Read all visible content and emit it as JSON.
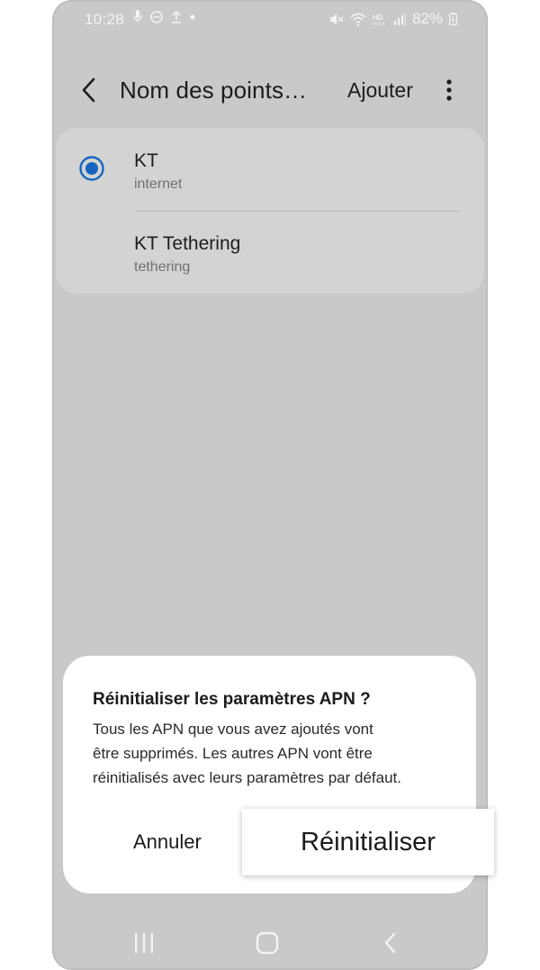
{
  "status_bar": {
    "time": "10:28",
    "battery": "82%",
    "left_icons": [
      "mic-icon",
      "dnd-icon",
      "upload-icon",
      "dot-icon"
    ],
    "right_icons": [
      "mute-icon",
      "wifi-icon",
      "hd-voice-icon",
      "signal-icon",
      "battery-icon"
    ]
  },
  "app_bar": {
    "title": "Nom des points…",
    "add_label": "Ajouter"
  },
  "apn_list": [
    {
      "name": "KT",
      "type": "internet",
      "selected": true
    },
    {
      "name": "KT Tethering",
      "type": "tethering",
      "selected": false
    }
  ],
  "dialog": {
    "title": "Réinitialiser les paramètres APN ?",
    "body_lines": [
      "Tous les APN que vous avez ajoutés vont",
      "être supprimés. Les autres APN vont être",
      "réinitialisés avec leurs paramètres par défaut."
    ],
    "cancel_label": "Annuler",
    "confirm_label": "Réinitialiser"
  },
  "colors": {
    "background_dim": "#c9c9c9",
    "card": "#d3d3d3",
    "accent": "#1565c0",
    "dialog_bg": "#ffffff"
  }
}
